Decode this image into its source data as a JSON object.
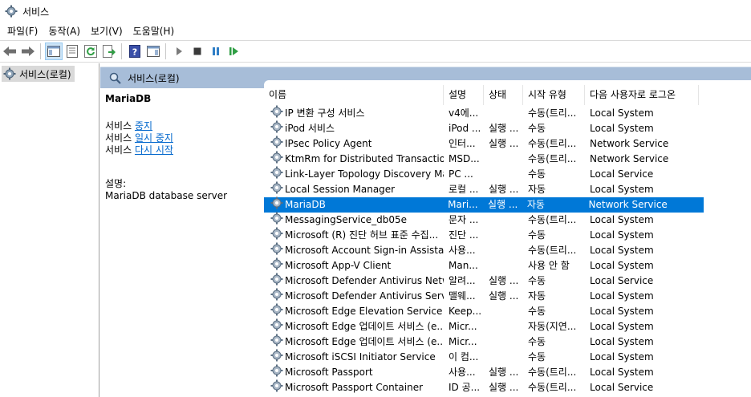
{
  "window": {
    "title": "서비스"
  },
  "menu": [
    "파일(F)",
    "동작(A)",
    "보기(V)",
    "도움말(H)"
  ],
  "toolbar": {
    "buttons": [
      "back-arrow-icon",
      "forward-arrow-icon",
      "show-hide-console-tree-icon",
      "properties-icon",
      "refresh-icon",
      "export-list-icon",
      "help-icon",
      "show-action-pane-icon",
      "start-service-icon",
      "stop-service-icon",
      "pause-service-icon",
      "resume-service-icon"
    ]
  },
  "tree": {
    "root_label": "서비스(로컬)"
  },
  "content": {
    "header_title": "서비스(로컬)"
  },
  "detail": {
    "service_name": "MariaDB",
    "stop_prefix": "서비스 ",
    "stop_link": "중지",
    "pause_prefix": "서비스 ",
    "pause_link": "일시 중지",
    "restart_prefix": "서비스 ",
    "restart_link": "다시 시작",
    "description_label": "설명:",
    "description": "MariaDB database server"
  },
  "table": {
    "sort_indicator": "^",
    "columns": [
      "이름",
      "설명",
      "상태",
      "시작 유형",
      "다음 사용자로 로그온"
    ],
    "rows": [
      [
        "IP 변환 구성 서비스",
        "v4에...",
        "",
        "수동(트리...",
        "Local System"
      ],
      [
        "iPod 서비스",
        "iPod ...",
        "실행 ...",
        "수동",
        "Local System"
      ],
      [
        "IPsec Policy Agent",
        "인터...",
        "실행 ...",
        "수동(트리...",
        "Network Service"
      ],
      [
        "KtmRm for Distributed Transaction...",
        "MSD...",
        "",
        "수동(트리...",
        "Network Service"
      ],
      [
        "Link-Layer Topology Discovery Ma...",
        "PC ...",
        "",
        "수동",
        "Local Service"
      ],
      [
        "Local Session Manager",
        "로컬 ...",
        "실행 ...",
        "자동",
        "Local System"
      ],
      [
        "MariaDB",
        "Mari...",
        "실행 ...",
        "자동",
        "Network Service"
      ],
      [
        "MessagingService_db05e",
        "문자 ...",
        "",
        "수동(트리...",
        "Local System"
      ],
      [
        "Microsoft (R) 진단 허브 표준 수집...",
        "진단 ...",
        "",
        "수동",
        "Local System"
      ],
      [
        "Microsoft Account Sign-in Assistant",
        "사용...",
        "",
        "수동(트리...",
        "Local System"
      ],
      [
        "Microsoft App-V Client",
        "Man...",
        "",
        "사용 안 함",
        "Local System"
      ],
      [
        "Microsoft Defender Antivirus Netw...",
        "알려...",
        "실행 ...",
        "수동",
        "Local Service"
      ],
      [
        "Microsoft Defender Antivirus Service",
        "맬웨...",
        "실행 ...",
        "자동",
        "Local System"
      ],
      [
        "Microsoft Edge Elevation Service (...",
        "Keep...",
        "",
        "수동",
        "Local System"
      ],
      [
        "Microsoft Edge 업데이트 서비스 (e...",
        "Micr...",
        "",
        "자동(지연...",
        "Local System"
      ],
      [
        "Microsoft Edge 업데이트 서비스 (e...",
        "Micr...",
        "",
        "수동",
        "Local System"
      ],
      [
        "Microsoft iSCSI Initiator Service",
        "이 컴...",
        "",
        "수동",
        "Local System"
      ],
      [
        "Microsoft Passport",
        "사용...",
        "실행 ...",
        "수동(트리...",
        "Local System"
      ],
      [
        "Microsoft Passport Container",
        "ID 공...",
        "실행 ...",
        "수동(트리...",
        "Local Service"
      ]
    ],
    "selected_row": 6
  },
  "colors": {
    "selection": "#0078d7",
    "header_band": "#a7bdd8",
    "link": "#0066cc"
  }
}
